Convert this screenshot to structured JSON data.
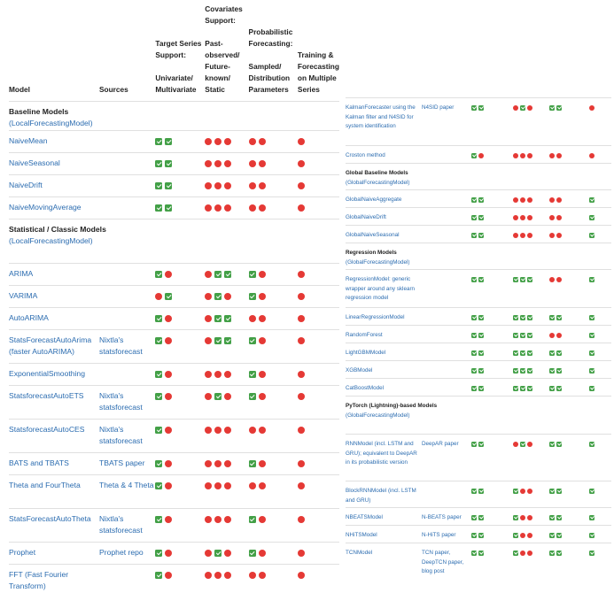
{
  "colors": {
    "link": "#2b6cb0",
    "yes": "#43a047",
    "no": "#e53935"
  },
  "legend_icons": {
    "y": "green-check-icon",
    "n": "red-circle-icon"
  },
  "headers": {
    "model": "Model",
    "sources": "Sources",
    "target": "Target Series Support:\n\nUnivariate/ Multivariate",
    "covariates": "Covariates Support:\n\nPast-observed/ Future-known/ Static",
    "probabilistic": "Probabilistic Forecasting:\n\nSampled/ Distribution Parameters",
    "training": "Training & Forecasting on Multiple Series"
  },
  "left_rows": [
    {
      "section": true,
      "title": "Baseline Models",
      "sub": "(LocalForecastingModel)"
    },
    {
      "name": "NaiveMean",
      "source": "",
      "t": "yy",
      "c": "nnn",
      "p": "nn",
      "m": "n"
    },
    {
      "name": "NaiveSeasonal",
      "source": "",
      "t": "yy",
      "c": "nnn",
      "p": "nn",
      "m": "n"
    },
    {
      "name": "NaiveDrift",
      "source": "",
      "t": "yy",
      "c": "nnn",
      "p": "nn",
      "m": "n"
    },
    {
      "name": "NaiveMovingAverage",
      "source": "",
      "t": "yy",
      "c": "nnn",
      "p": "nn",
      "m": "n"
    },
    {
      "section": true,
      "title": "Statistical / Classic Models",
      "sub": "(LocalForecastingModel)"
    },
    {
      "name": "ARIMA",
      "source": "",
      "t": "yn",
      "c": "nyy",
      "p": "yn",
      "m": "n"
    },
    {
      "name": "VARIMA",
      "source": "",
      "t": "ny",
      "c": "nyn",
      "p": "yn",
      "m": "n"
    },
    {
      "name": "AutoARIMA",
      "source": "",
      "t": "yn",
      "c": "nyy",
      "p": "nn",
      "m": "n"
    },
    {
      "name": "StatsForecastAutoArima (faster AutoARIMA)",
      "source": "Nixtla's statsforecast",
      "t": "yn",
      "c": "nyy",
      "p": "yn",
      "m": "n"
    },
    {
      "name": "ExponentialSmoothing",
      "source": "",
      "t": "yn",
      "c": "nnn",
      "p": "yn",
      "m": "n"
    },
    {
      "name": "StatsforecastAutoETS",
      "source": "Nixtla's statsforecast",
      "t": "yn",
      "c": "nyn",
      "p": "yn",
      "m": "n"
    },
    {
      "name": "StatsforecastAutoCES",
      "source": "Nixtla's statsforecast",
      "t": "yn",
      "c": "nnn",
      "p": "nn",
      "m": "n"
    },
    {
      "name": "BATS and TBATS",
      "source": "TBATS paper",
      "t": "yn",
      "c": "nnn",
      "p": "yn",
      "m": "n"
    },
    {
      "name": "Theta and FourTheta",
      "source": "Theta & 4 Theta",
      "t": "yn",
      "c": "nnn",
      "p": "nn",
      "m": "n"
    },
    {
      "name": "StatsForecastAutoTheta",
      "source": "Nixtla's statsforecast",
      "t": "yn",
      "c": "nnn",
      "p": "yn",
      "m": "n"
    },
    {
      "name": "Prophet",
      "source": "Prophet repo",
      "t": "yn",
      "c": "nyn",
      "p": "yn",
      "m": "n"
    },
    {
      "name": "FFT (Fast Fourier Transform)",
      "source": "",
      "t": "yn",
      "c": "nnn",
      "p": "nn",
      "m": "n"
    }
  ],
  "right_rows": [
    {
      "name": "KalmanForecaster using the Kalman filter and N4SID for system identification",
      "source": "N4SID paper",
      "t": "yy",
      "c": "nyn",
      "p": "yy",
      "m": "n"
    },
    {
      "name": "Croston method",
      "source": "",
      "t": "yn",
      "c": "nnn",
      "p": "nn",
      "m": "n"
    },
    {
      "section": true,
      "title": "Global Baseline Models",
      "sub": "(GlobalForecastingModel)"
    },
    {
      "name": "GlobalNaiveAggregate",
      "source": "",
      "t": "yy",
      "c": "nnn",
      "p": "nn",
      "m": "y"
    },
    {
      "name": "GlobalNaiveDrift",
      "source": "",
      "t": "yy",
      "c": "nnn",
      "p": "nn",
      "m": "y"
    },
    {
      "name": "GlobalNaiveSeasonal",
      "source": "",
      "t": "yy",
      "c": "nnn",
      "p": "nn",
      "m": "y"
    },
    {
      "section": true,
      "title": "Regression Models",
      "sub": "(GlobalForecastingModel)"
    },
    {
      "name": "RegressionModel: generic wrapper around any sklearn regression model",
      "source": "",
      "t": "yy",
      "c": "yyy",
      "p": "nn",
      "m": "y"
    },
    {
      "name": "LinearRegressionModel",
      "source": "",
      "t": "yy",
      "c": "yyy",
      "p": "yy",
      "m": "y"
    },
    {
      "name": "RandomForest",
      "source": "",
      "t": "yy",
      "c": "yyy",
      "p": "nn",
      "m": "y"
    },
    {
      "name": "LightGBMModel",
      "source": "",
      "t": "yy",
      "c": "yyy",
      "p": "yy",
      "m": "y"
    },
    {
      "name": "XGBModel",
      "source": "",
      "t": "yy",
      "c": "yyy",
      "p": "yy",
      "m": "y"
    },
    {
      "name": "CatBoostModel",
      "source": "",
      "t": "yy",
      "c": "yyy",
      "p": "yy",
      "m": "y"
    },
    {
      "section": true,
      "title": "PyTorch (Lightning)-based Models",
      "sub": "(GlobalForecastingModel)"
    },
    {
      "name": "RNNModel (incl. LSTM and GRU); equivalent to DeepAR in its probabilistic version",
      "source": "DeepAR paper",
      "t": "yy",
      "c": "nyn",
      "p": "yy",
      "m": "y"
    },
    {
      "name": "BlockRNNModel (incl. LSTM and GRU)",
      "source": "",
      "t": "yy",
      "c": "ynn",
      "p": "yy",
      "m": "y"
    },
    {
      "name": "NBEATSModel",
      "source": "N-BEATS paper",
      "t": "yy",
      "c": "ynn",
      "p": "yy",
      "m": "y"
    },
    {
      "name": "NHiTSModel",
      "source": "N-HiTS paper",
      "t": "yy",
      "c": "ynn",
      "p": "yy",
      "m": "y"
    },
    {
      "name": "TCNModel",
      "source": "TCN paper, DeepTCN paper, blog post",
      "t": "yy",
      "c": "ynn",
      "p": "yy",
      "m": "y"
    }
  ]
}
